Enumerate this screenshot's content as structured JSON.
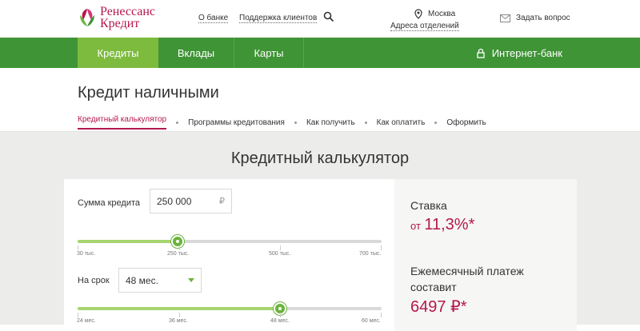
{
  "header": {
    "logo_line1": "Ренессанс",
    "logo_line2": "Кредит",
    "about": "О банке",
    "support": "Поддержка клиентов",
    "city": "Москва",
    "branches": "Адреса отделений",
    "ask": "Задать вопрос"
  },
  "mainnav": {
    "tabs": [
      "Кредиты",
      "Вклады",
      "Карты"
    ],
    "internet_bank": "Интернет-банк"
  },
  "page": {
    "title": "Кредит наличными",
    "subnav": [
      "Кредитный калькулятор",
      "Программы кредитования",
      "Как получить",
      "Как оплатить",
      "Оформить"
    ]
  },
  "calculator": {
    "title": "Кредитный калькулятор",
    "amount_label": "Сумма кредита",
    "amount_value": "250 000",
    "currency": "₽",
    "amount_ticks": [
      "30 тыс.",
      "250 тыс.",
      "500 тыс.",
      "700 тыс."
    ],
    "amount_fraction": 0.33,
    "term_label": "На срок",
    "term_value": "48 мес.",
    "term_ticks": [
      "24 мес.",
      "36 мес.",
      "48 мес.",
      "60 мес."
    ],
    "term_fraction": 0.667
  },
  "result": {
    "rate_label": "Ставка",
    "rate_prefix": "от",
    "rate_value": "11,3%*",
    "payment_label_1": "Ежемесячный платеж",
    "payment_label_2": "составит",
    "payment_value": "6497 ₽*"
  },
  "colors": {
    "brand": "#b5174f",
    "green": "#3f9436",
    "active_green": "#7dbb3e"
  }
}
